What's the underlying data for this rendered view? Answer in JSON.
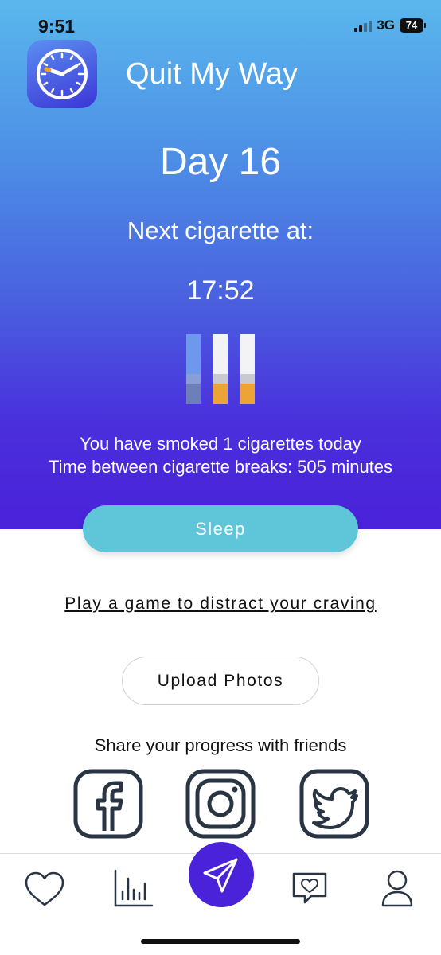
{
  "status_bar": {
    "time": "9:51",
    "network": "3G",
    "battery": "74"
  },
  "header": {
    "title": "Quit My Way",
    "app_icon": "clock-icon"
  },
  "progress": {
    "day_label": "Day 16",
    "next_label": "Next cigarette at:",
    "next_time": "17:52",
    "smoked_text": "You have smoked 1 cigarettes today",
    "interval_text": "Time between cigarette breaks: 505 minutes"
  },
  "actions": {
    "sleep_label": "Sleep",
    "game_link": "Play a game to distract your craving",
    "upload_label": "Upload Photos"
  },
  "share": {
    "label": "Share your progress with friends",
    "icons": [
      "facebook-icon",
      "instagram-icon",
      "twitter-icon"
    ]
  },
  "tabs": [
    "heart-icon",
    "bar-chart-icon",
    "send-icon",
    "chat-heart-icon",
    "profile-icon"
  ],
  "colors": {
    "accent": "#4a22da",
    "sleep_button": "#5fc5d9",
    "filter": "#eda437",
    "icon_stroke": "#2a3544"
  }
}
